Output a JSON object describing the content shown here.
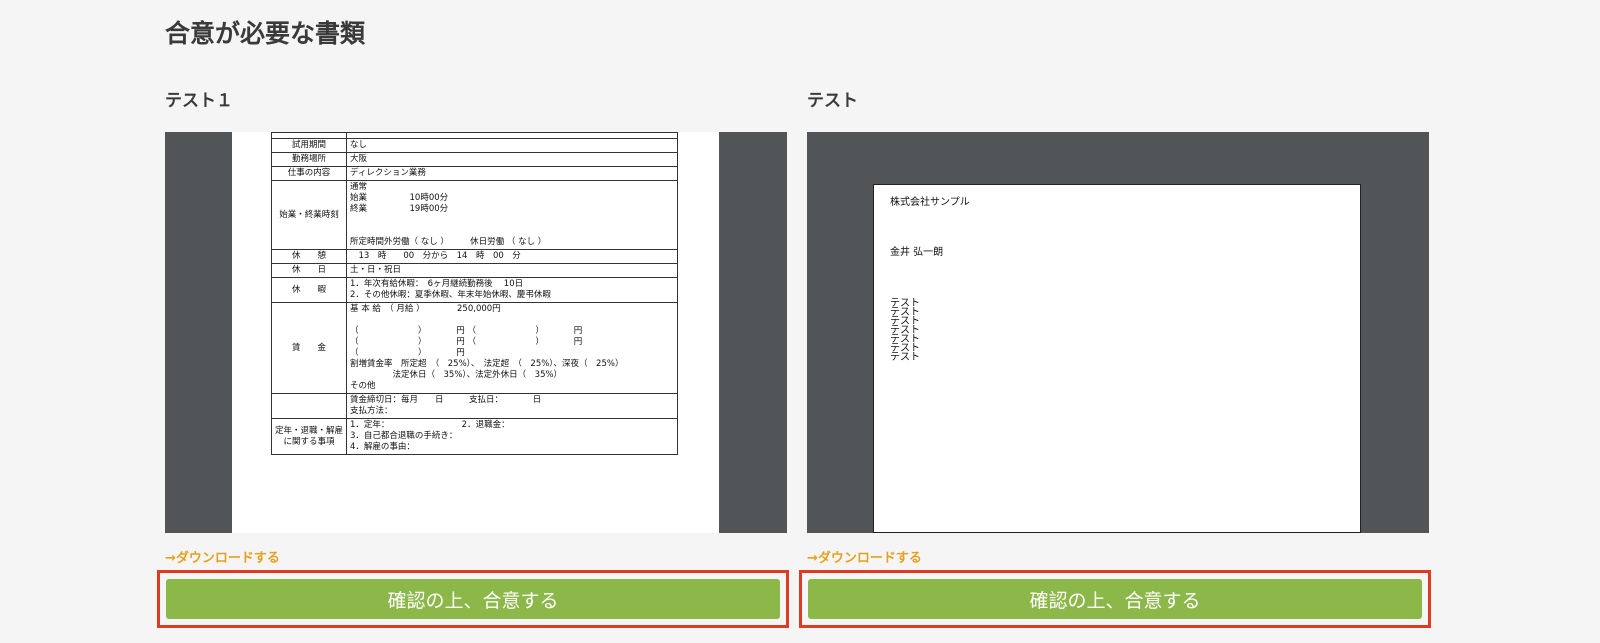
{
  "page": {
    "title": "合意が必要な書類"
  },
  "documents": [
    {
      "title": "テスト１",
      "download_label": "→ダウンロードする",
      "agree_label": "確認の上、合意する",
      "table_rows": [
        {
          "label": "",
          "value": ""
        },
        {
          "label": "試用期間",
          "value": "なし"
        },
        {
          "label": "勤務場所",
          "value": "大阪"
        },
        {
          "label": "仕事の内容",
          "value": "ディレクション業務"
        },
        {
          "label": "始業・終業時刻",
          "value": "通常\n始業　　　　　10時00分\n終業　　　　　19時00分\n\n\n所定時間外労働（ なし ）　　　休日労働 （ なし ）"
        },
        {
          "label": "休　　憩",
          "value": "　13　時　　00　分から　14　時　00　分"
        },
        {
          "label": "休　　日",
          "value": "土・日・祝日"
        },
        {
          "label": "休　　暇",
          "value": "1．年次有給休暇：　6ヶ月継続勤務後　 10日\n2．その他休暇：夏季休暇、年末年始休暇、慶弔休暇"
        },
        {
          "label": "賃　　金",
          "value": "基 本 給　（ 月給 ）　　　　 250,000円\n\n（　　　　　　　）　　　　円 （　　　　　　　）　　　　円\n（　　　　　　　）　　　　円 （　　　　　　　）　　　　円\n（　　　　　　　）　　　　円\n割増賃金率　所定超　（　25%）、　法定超　（　25%）、深夜（　25%）\n　　　　　法定休日（　35%）、法定外休日（　35%）\nその他"
        },
        {
          "label": "",
          "value": "賃金締切日：毎月　　日　　　支払日：　　　　日\n支払方法："
        },
        {
          "label": "定年・退職・解雇\nに関する事項",
          "value": "1．定年：　　　　　　　　　2．退職金：\n3．自己都合退職の手続き：\n4．解雇の事由："
        }
      ]
    },
    {
      "title": "テスト",
      "download_label": "→ダウンロードする",
      "agree_label": "確認の上、合意する",
      "letter": {
        "company": "株式会社サンプル",
        "person": "金井 弘一朗",
        "body": "テスト\nテスト\nテスト\nテスト\nテスト\nテスト\nテスト"
      }
    }
  ]
}
